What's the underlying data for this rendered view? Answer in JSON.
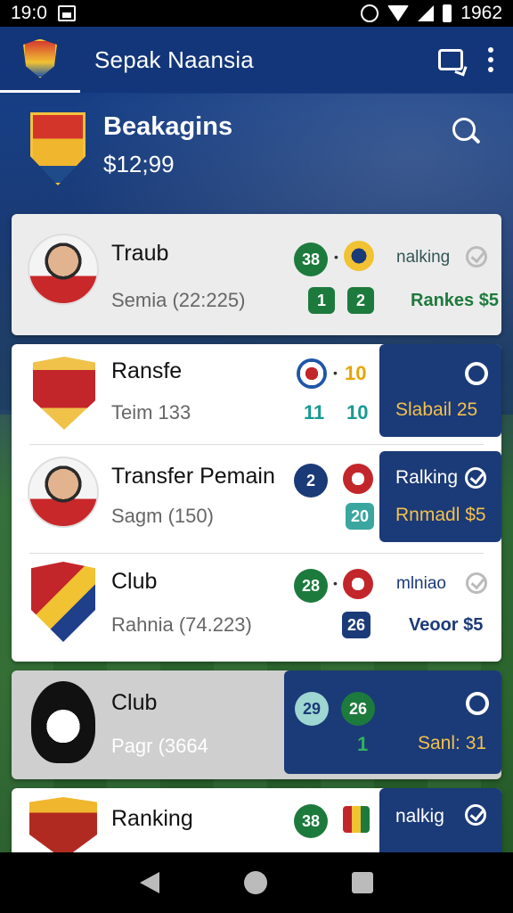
{
  "status_bar": {
    "time": "19:0",
    "battery": "1962"
  },
  "app_bar": {
    "title": "Sepak Naansia"
  },
  "header": {
    "title": "Beakagins",
    "amount": "$12;99"
  },
  "cards": [
    {
      "name": "Traub",
      "sub": "Semia (22:225)",
      "badge_top": "38",
      "badges_bottom": [
        "1",
        "2"
      ],
      "ranking_label": "nalking",
      "ranking_value": "Rankes $5"
    },
    {
      "name": "Ransfe",
      "sub": "Teim 133",
      "num_a": "10",
      "num_b1": "11",
      "num_b2": "10",
      "panel_line": "Slabail 25"
    },
    {
      "name": "Transfer Pemain",
      "sub": "Sagm (150)",
      "badge_top": "2",
      "badge_bottom": "20",
      "panel_label": "Ralking",
      "panel_value": "Rnmadl $5"
    },
    {
      "name": "Club",
      "sub": "Rahnia (74.223)",
      "badge_top": "28",
      "badge_bottom": "26",
      "ranking_label": "mlniao",
      "ranking_value": "Veoor $5"
    },
    {
      "name": "Club",
      "sub": "Pagr (3664",
      "badge_a": "29",
      "badge_b": "26",
      "num_c": "1",
      "panel_value": "Sanl: 31"
    },
    {
      "name": "Ranking",
      "badge_top": "38",
      "panel_label": "nalkig"
    }
  ]
}
